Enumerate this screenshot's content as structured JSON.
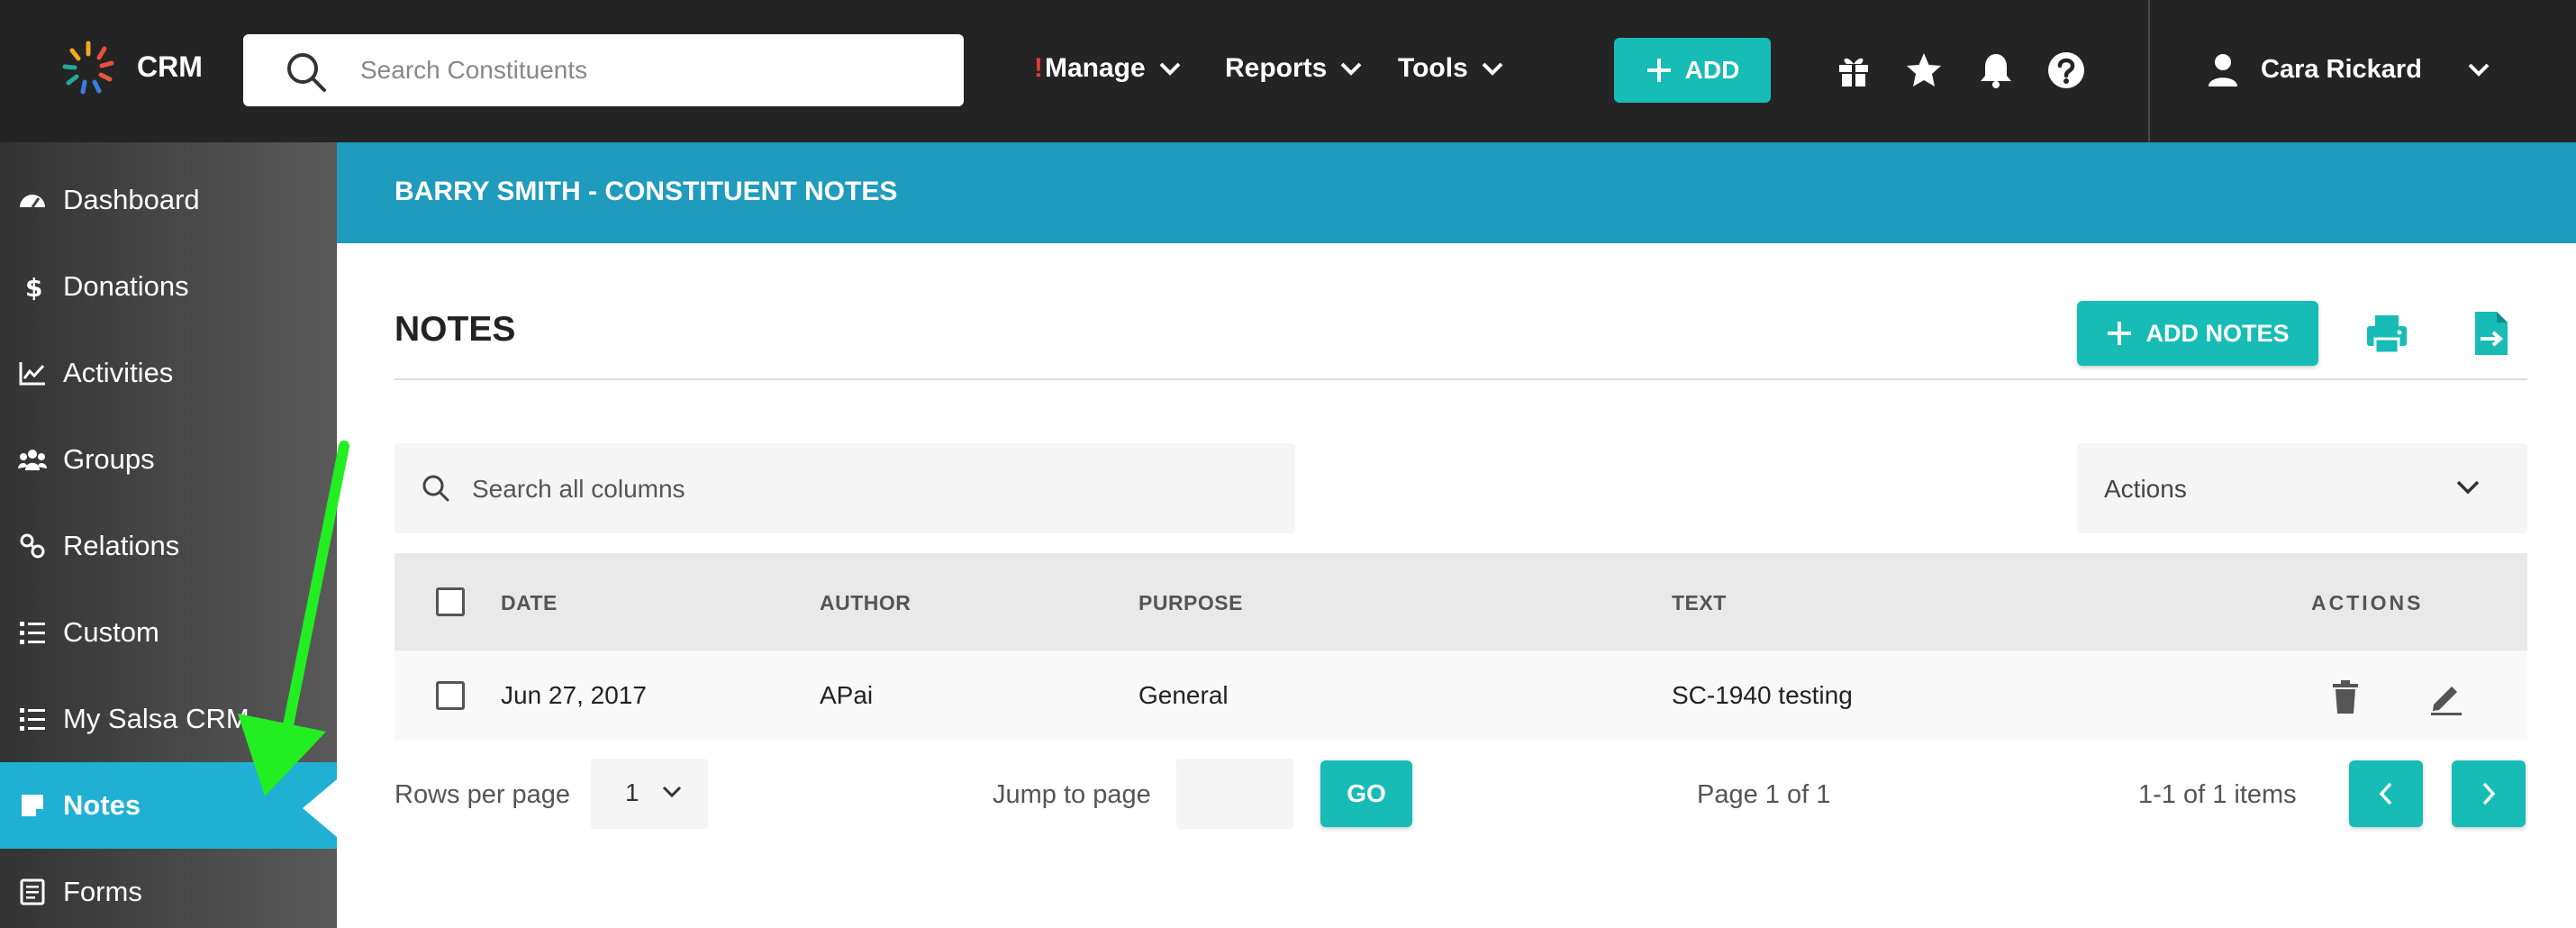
{
  "app": {
    "brand": "CRM",
    "search_placeholder": "Search Constituents",
    "nav": {
      "manage_marker": "!",
      "manage": "Manage",
      "reports": "Reports",
      "tools": "Tools"
    },
    "add_label": "ADD",
    "user_name": "Cara Rickard",
    "icons": [
      "gift-icon",
      "star-icon",
      "bell-icon",
      "help-icon",
      "user-icon"
    ]
  },
  "sidebar": {
    "items": [
      {
        "label": "Dashboard",
        "icon": "gauge-icon"
      },
      {
        "label": "Donations",
        "icon": "dollar-icon"
      },
      {
        "label": "Activities",
        "icon": "chart-line-icon"
      },
      {
        "label": "Groups",
        "icon": "users-icon"
      },
      {
        "label": "Relations",
        "icon": "link-icon"
      },
      {
        "label": "Custom",
        "icon": "list-icon"
      },
      {
        "label": "My Salsa CRM",
        "icon": "list-icon"
      },
      {
        "label": "Notes",
        "icon": "note-icon",
        "active": true
      },
      {
        "label": "Forms",
        "icon": "form-icon"
      }
    ]
  },
  "page": {
    "banner_title": "BARRY SMITH - CONSTITUENT NOTES",
    "section_title": "NOTES",
    "add_notes_label": "ADD NOTES",
    "search_columns_placeholder": "Search all columns",
    "actions_select": "Actions"
  },
  "table": {
    "headers": {
      "date": "DATE",
      "author": "AUTHOR",
      "purpose": "PURPOSE",
      "text": "TEXT",
      "actions": "ACTIONS"
    },
    "rows": [
      {
        "date": "Jun 27, 2017",
        "author": "APai",
        "purpose": "General",
        "text": "SC-1940 testing"
      }
    ]
  },
  "pagination": {
    "rows_per_page_label": "Rows per page",
    "rows_per_page_value": "1",
    "jump_label": "Jump to page",
    "go_label": "GO",
    "page_status": "Page 1 of 1",
    "items_status": "1-1 of 1 items"
  },
  "colors": {
    "topbar": "#242424",
    "teal_button": "#17bcb6",
    "banner": "#1f9bbd",
    "active_sidebar": "#1fb0d3",
    "annotation_arrow": "#22ee22"
  }
}
